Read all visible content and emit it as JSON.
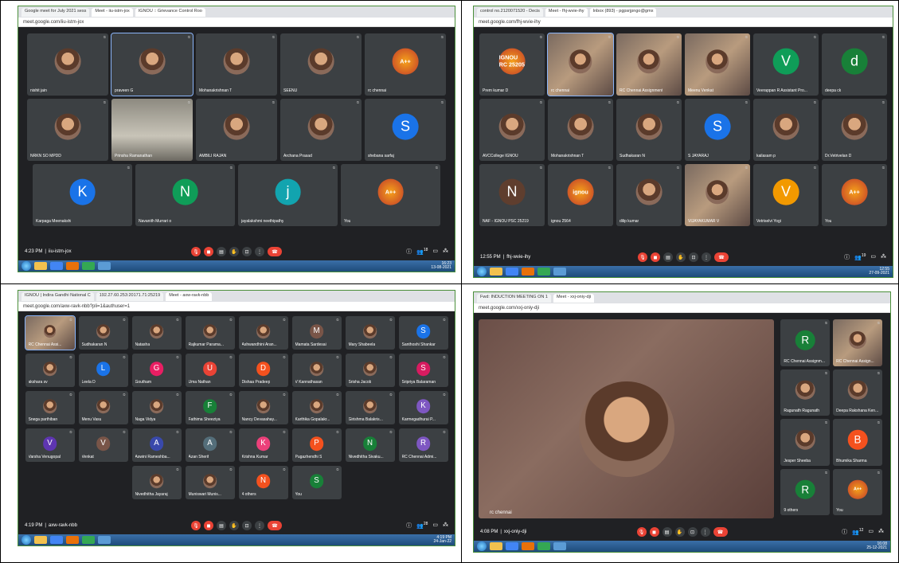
{
  "panels": [
    {
      "id": "p1",
      "tabs": [
        "Google meet for July 2021 sess",
        "Meet - iiu-istm-jox",
        "IGNOU :: Grievance Control Roo"
      ],
      "url": "meet.google.com/iiu-istm-jox",
      "time": "4:23 PM",
      "meeting_code": "iiu-istm-jox",
      "tray_time": "16:23",
      "tray_date": "13-08-2021",
      "participant_count": "18",
      "tiles": [
        {
          "name": "nishit jain",
          "kind": "photo"
        },
        {
          "name": "praveen G",
          "kind": "photo",
          "speaking": true
        },
        {
          "name": "Mohanakrishnan T",
          "kind": "photo"
        },
        {
          "name": "SEENU",
          "kind": "photo"
        },
        {
          "name": "rc chennai",
          "kind": "logo",
          "logo_text": "A++"
        },
        {
          "name": "NRKN SO MPDD",
          "kind": "photo"
        },
        {
          "name": "Prinsha Ramanathan",
          "kind": "room"
        },
        {
          "name": "AMBILI RAJAN",
          "kind": "photo"
        },
        {
          "name": "Archana Prasad",
          "kind": "photo"
        },
        {
          "name": "shebana sarfaj",
          "kind": "letter",
          "letter": "S",
          "color": "#1a73e8"
        },
        {
          "name": "Karpaga Meenakshi",
          "kind": "letter",
          "letter": "K",
          "color": "#1a73e8"
        },
        {
          "name": "Navanith Murrari o",
          "kind": "letter",
          "letter": "N",
          "color": "#0f9d58"
        },
        {
          "name": "jayalakshmi neethipathy",
          "kind": "letter",
          "letter": "j",
          "color": "#12a4af"
        },
        {
          "name": "You",
          "kind": "logo",
          "logo_text": "A++"
        }
      ]
    },
    {
      "id": "p2",
      "tabs": [
        "control no.2120071520 - Decis",
        "Meet - fhj-wvie-ihy",
        "Inbox (893) - pgpsrjpngo@gmx"
      ],
      "url": "meet.google.com/fhj-wvie-ihy",
      "time": "12:55 PM",
      "meeting_code": "fhj-wvie-ihy",
      "tray_time": "12:55",
      "tray_date": "27-09-2021",
      "participant_count": "19",
      "tiles": [
        {
          "name": "Prem kumar D",
          "kind": "logo",
          "logo_text": "IGNOU RC 25205"
        },
        {
          "name": "rc chennai",
          "kind": "video",
          "speaking": true
        },
        {
          "name": "RC Chennai Assignment",
          "kind": "video"
        },
        {
          "name": "Meenu Venkat",
          "kind": "video"
        },
        {
          "name": "Veerappan R Assistant Pro...",
          "kind": "letter",
          "letter": "V",
          "color": "#0f9d58"
        },
        {
          "name": "deepa ck",
          "kind": "letter",
          "letter": "d",
          "color": "#188038"
        },
        {
          "name": "AVCCollege IGNOU",
          "kind": "photo"
        },
        {
          "name": "Mohanakrishnan T",
          "kind": "photo"
        },
        {
          "name": "Sudhakaran N",
          "kind": "photo"
        },
        {
          "name": "S JAYARAJ",
          "kind": "letter",
          "letter": "S",
          "color": "#1a73e8"
        },
        {
          "name": "kailasam p",
          "kind": "photo"
        },
        {
          "name": "Dr.Vetrivelan D",
          "kind": "photo"
        },
        {
          "name": "NAF - IGNOU PSC 25219",
          "kind": "letter",
          "letter": "N",
          "color": "#5f3e2e"
        },
        {
          "name": "ignou 2564",
          "kind": "logo",
          "logo_text": "ignou"
        },
        {
          "name": "dilip kumar",
          "kind": "photo"
        },
        {
          "name": "VIJAYAKUMAR V",
          "kind": "video"
        },
        {
          "name": "Vetriselvi Yogi",
          "kind": "letter",
          "letter": "V",
          "color": "#f29900"
        },
        {
          "name": "You",
          "kind": "logo",
          "logo_text": "A++"
        }
      ]
    },
    {
      "id": "p3",
      "tabs": [
        "IGNOU | Indira Gandhi National C",
        "192.27.60.253:20171.71:25219",
        "Meet - axw-ravk-nbb"
      ],
      "url": "meet.google.com/axw-ravk-nbb?pli=1&authuser=1",
      "time": "4:19 PM",
      "meeting_code": "axw-ravk-nbb",
      "tray_time": "4:19 PM",
      "tray_date": "24-Jan-22",
      "participant_count": "28",
      "tiles": [
        {
          "name": "RC Chennai Assi...",
          "kind": "video",
          "speaking": true
        },
        {
          "name": "Sudhakaran N",
          "kind": "photo"
        },
        {
          "name": "Natasha",
          "kind": "photo"
        },
        {
          "name": "Rajkumar Parama...",
          "kind": "photo"
        },
        {
          "name": "Ashwandhini Aran...",
          "kind": "photo"
        },
        {
          "name": "Mamata Sardesai",
          "kind": "letter",
          "letter": "M",
          "color": "#795548"
        },
        {
          "name": "Mary Shabeela",
          "kind": "photo"
        },
        {
          "name": "Santhoshi Shankar",
          "kind": "letter",
          "letter": "S",
          "color": "#1a73e8"
        },
        {
          "name": "akshara sv",
          "kind": "photo"
        },
        {
          "name": "Leela D",
          "kind": "letter",
          "letter": "L",
          "color": "#1a73e8"
        },
        {
          "name": "Goutham",
          "kind": "letter",
          "letter": "G",
          "color": "#e91e63"
        },
        {
          "name": "Uma Nathan",
          "kind": "letter",
          "letter": "U",
          "color": "#ea4335"
        },
        {
          "name": "Dishaa Pradeep",
          "kind": "letter",
          "letter": "D",
          "color": "#f4511e"
        },
        {
          "name": "V Kannathasan",
          "kind": "photo"
        },
        {
          "name": "Srisha Jacob",
          "kind": "photo"
        },
        {
          "name": "Sripriya Balaraman",
          "kind": "letter",
          "letter": "S",
          "color": "#d81b60"
        },
        {
          "name": "Snega parthiban",
          "kind": "photo"
        },
        {
          "name": "Menu Vasu",
          "kind": "photo"
        },
        {
          "name": "Naga Vidya",
          "kind": "photo"
        },
        {
          "name": "Fathima Sheeziya",
          "kind": "letter",
          "letter": "F",
          "color": "#188038"
        },
        {
          "name": "Nancy Devasahay...",
          "kind": "photo"
        },
        {
          "name": "Karthika Gopalakr...",
          "kind": "photo"
        },
        {
          "name": "Girishma Balakris...",
          "kind": "photo"
        },
        {
          "name": "Karmegadhurai P...",
          "kind": "letter",
          "letter": "K",
          "color": "#7e57c2"
        },
        {
          "name": "Varsha Venugopal",
          "kind": "letter",
          "letter": "V",
          "color": "#5e35b1"
        },
        {
          "name": "Venkat",
          "kind": "letter",
          "letter": "V",
          "color": "#795548"
        },
        {
          "name": "Aswini Rameshba...",
          "kind": "letter",
          "letter": "A",
          "color": "#3949ab"
        },
        {
          "name": "Azan Sherif",
          "kind": "letter",
          "letter": "A",
          "color": "#546e7a"
        },
        {
          "name": "Krishna Kumar",
          "kind": "letter",
          "letter": "K",
          "color": "#ec407a"
        },
        {
          "name": "Pugazhendhi S",
          "kind": "letter",
          "letter": "P",
          "color": "#f4511e"
        },
        {
          "name": "Nivedhitha Sivaku...",
          "kind": "letter",
          "letter": "N",
          "color": "#188038"
        },
        {
          "name": "RC Chennai Admi...",
          "kind": "letter",
          "letter": "R",
          "color": "#7e57c2"
        },
        {
          "name": "Nivedhitha Jayaraj",
          "kind": "photo"
        },
        {
          "name": "Muniswari Munis...",
          "kind": "photo"
        },
        {
          "name": "4 others",
          "kind": "letter",
          "letter": "N",
          "color": "#f4511e"
        },
        {
          "name": "You",
          "kind": "letter",
          "letter": "S",
          "color": "#188038"
        }
      ]
    },
    {
      "id": "p4",
      "tabs": [
        "Fwd: INDUCTION MEETING ON 1",
        "Meet - xxj-oniy-dji"
      ],
      "url": "meet.google.com/xxj-oniy-dji",
      "time": "4:08 PM",
      "meeting_code": "xxj-oniy-dji",
      "tray_time": "16:08",
      "tray_date": "25-12-2021",
      "participant_count": "12",
      "main_speaker": "rc chennai",
      "tiles": [
        {
          "name": "RC Chennai Assignm...",
          "kind": "letter",
          "letter": "R",
          "color": "#188038"
        },
        {
          "name": "RC Chennai Assign...",
          "kind": "video"
        },
        {
          "name": "Ragunath Ragunath",
          "kind": "photo"
        },
        {
          "name": "Deepa Rakshana Ken...",
          "kind": "photo"
        },
        {
          "name": "Jesper Sheeba",
          "kind": "photo"
        },
        {
          "name": "Bhumika Sharma",
          "kind": "letter",
          "letter": "B",
          "color": "#f4511e"
        },
        {
          "name": "9 others",
          "kind": "letter",
          "letter": "R",
          "color": "#188038"
        },
        {
          "name": "You",
          "kind": "logo",
          "logo_text": "A++"
        }
      ]
    }
  ],
  "icons": {
    "mic_off": "mic-off-icon",
    "cam_off": "camera-off-icon",
    "end_call": "phone-icon"
  }
}
